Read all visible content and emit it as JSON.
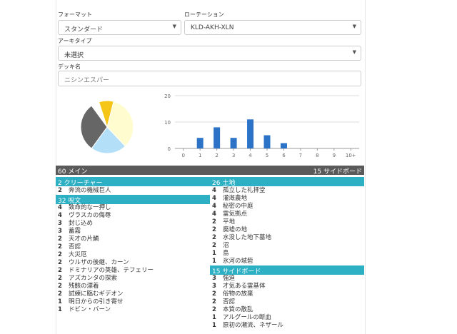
{
  "form": {
    "format_label": "フォーマット",
    "format_value": "スタンダード",
    "rotation_label": "ローテーション",
    "rotation_value": "KLD-AKH-XLN",
    "archetype_label": "アーキタイプ",
    "archetype_value": "未選択",
    "deckname_label": "デッキ名",
    "deckname_placeholder": "ニシンエスパー"
  },
  "pie": {
    "slices": [
      {
        "fraction": 0.34,
        "color": "#fffdd0"
      },
      {
        "fraction": 0.22,
        "color": "#b3dff8"
      },
      {
        "fraction": 0.3,
        "color": "#666666"
      },
      {
        "fraction": 0.05,
        "color": "#ffffff"
      },
      {
        "fraction": 0.09,
        "color": "#f5c518"
      }
    ]
  },
  "chart_data": {
    "type": "bar",
    "categories": [
      "0",
      "1",
      "2",
      "3",
      "4",
      "5",
      "6",
      "7",
      "8",
      "9",
      "10+"
    ],
    "values": [
      0,
      4,
      8,
      4,
      11,
      5,
      2,
      0,
      0,
      0,
      0
    ],
    "ylim": [
      0,
      20
    ],
    "yticks": [
      "0",
      "10",
      "20"
    ],
    "color": "#2c73c8"
  },
  "deck": {
    "main_header": "60 メイン",
    "side_header": "15 サイドボード"
  },
  "left_sections": [
    {
      "title": "2 クリーチャー",
      "items": [
        {
          "n": "2",
          "name": "奔流の機械巨人"
        }
      ]
    },
    {
      "title": "32 呪文",
      "items": [
        {
          "n": "4",
          "name": "致命的な一押し"
        },
        {
          "n": "4",
          "name": "ヴラスカの侮辱"
        },
        {
          "n": "3",
          "name": "封じ込め"
        },
        {
          "n": "3",
          "name": "蓄霧"
        },
        {
          "n": "2",
          "name": "天才の片鱗"
        },
        {
          "n": "2",
          "name": "否認"
        },
        {
          "n": "2",
          "name": "大災厄"
        },
        {
          "n": "2",
          "name": "ウルザの後継、カーン"
        },
        {
          "n": "2",
          "name": "ドミナリアの英雄、テフェリー"
        },
        {
          "n": "2",
          "name": "アズカンタの探索"
        },
        {
          "n": "2",
          "name": "残骸の漂着"
        },
        {
          "n": "2",
          "name": "試練に臨むギデオン"
        },
        {
          "n": "1",
          "name": "明日からの引き寄せ"
        },
        {
          "n": "1",
          "name": "ドビン・バーン"
        }
      ]
    }
  ],
  "right_sections": [
    {
      "title": "26 土地",
      "items": [
        {
          "n": "4",
          "name": "孤立した礼拝堂"
        },
        {
          "n": "4",
          "name": "灌漑農地"
        },
        {
          "n": "4",
          "name": "秘密の中庭"
        },
        {
          "n": "4",
          "name": "霊気拠点"
        },
        {
          "n": "2",
          "name": "平地"
        },
        {
          "n": "2",
          "name": "廃墟の地"
        },
        {
          "n": "2",
          "name": "水没した地下墓地"
        },
        {
          "n": "2",
          "name": "沼"
        },
        {
          "n": "1",
          "name": "島"
        },
        {
          "n": "1",
          "name": "氷河の城砦"
        }
      ]
    },
    {
      "title": "15 サイドボード",
      "items": [
        {
          "n": "3",
          "name": "強迫"
        },
        {
          "n": "3",
          "name": "才気ある霊基体"
        },
        {
          "n": "2",
          "name": "俗物の放棄"
        },
        {
          "n": "2",
          "name": "否認"
        },
        {
          "n": "2",
          "name": "本質の散乱"
        },
        {
          "n": "1",
          "name": "アルグールの断血"
        },
        {
          "n": "1",
          "name": "原初の潮流、ネザール"
        }
      ]
    }
  ]
}
